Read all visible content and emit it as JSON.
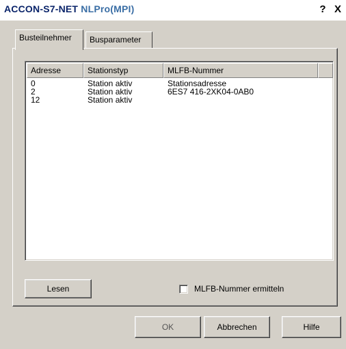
{
  "window": {
    "title_prefix": "ACCON-S7-NET",
    "title_suffix": " NLPro(MPI)",
    "help_button": "?",
    "close_button": "X"
  },
  "tabs": [
    {
      "label": "Busteilnehmer",
      "active": true
    },
    {
      "label": "Busparameter",
      "active": false
    }
  ],
  "list": {
    "columns": [
      "Adresse",
      "Stationstyp",
      "MLFB-Nummer"
    ],
    "rows": [
      {
        "address": "0",
        "type": "Station aktiv",
        "mlfb": "Stationsadresse"
      },
      {
        "address": "2",
        "type": "Station aktiv",
        "mlfb": "6ES7 416-2XK04-0AB0"
      },
      {
        "address": "12",
        "type": "Station aktiv",
        "mlfb": ""
      }
    ]
  },
  "read_button": "Lesen",
  "checkbox": {
    "label": "MLFB-Nummer ermitteln",
    "checked": false
  },
  "buttons": {
    "ok": "OK",
    "cancel": "Abbrechen",
    "help": "Hilfe"
  },
  "colors": {
    "title_text": "#0a246a",
    "dialog_face": "#d4d0c8"
  }
}
